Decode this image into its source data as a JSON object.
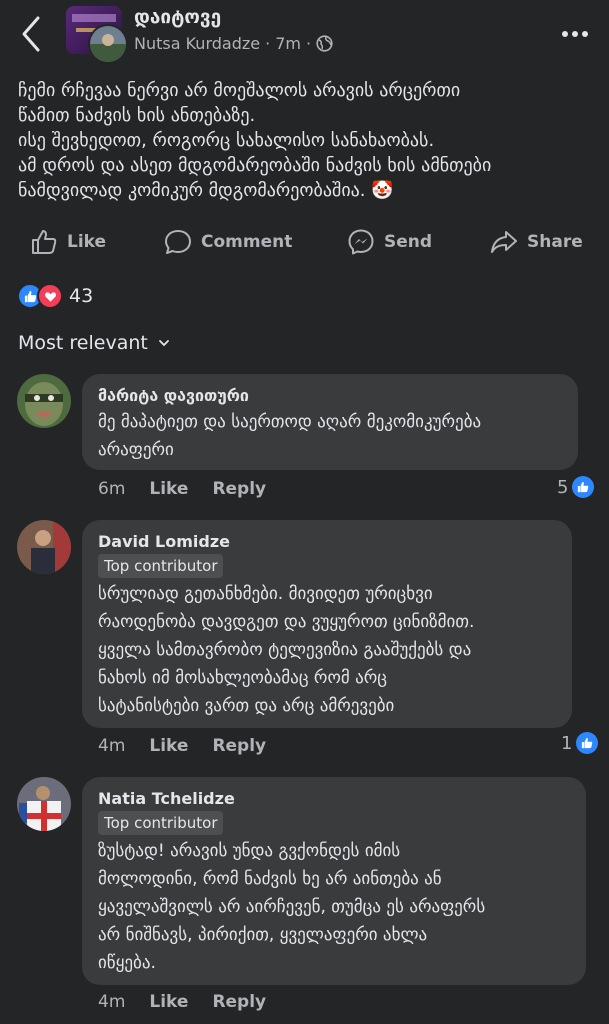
{
  "header": {
    "group_name": "დაიტოვე",
    "author": "Nutsa Kurdadze",
    "separator": "·",
    "time": "7m",
    "separator2": "·"
  },
  "post": {
    "lines": [
      "ჩემი რჩევაა ნერვი არ მოეშალოს არავის არცერთი",
      "წამით ნაძვის ხის ანთებაზე.",
      "ისე შევხედოთ, როგორც სახალისო სანახაობას.",
      "ამ დროს და ასეთ მდგომარეობაში ნაძვის ხის ამნთები",
      "ნამდვილად კომიკურ მდგომარეობაშია. 🤡"
    ]
  },
  "actions": {
    "like": "Like",
    "comment": "Comment",
    "send": "Send",
    "share": "Share"
  },
  "reactions": {
    "count": "43"
  },
  "sort": {
    "label": "Most relevant"
  },
  "comments": [
    {
      "name": "მარიტა დავითური",
      "lines": [
        "მე მაპატიეთ და საერთოდ აღარ მეკომიკურება",
        "არაფერი"
      ],
      "time": "6m",
      "like": "Like",
      "reply": "Reply",
      "reactions": "5"
    },
    {
      "name": "David Lomidze",
      "badge": "Top contributor",
      "lines": [
        "სრულიად გეთანხმები. მივიდეთ ურიცხვი",
        "რაოდენობა დავდგეთ და ვუყუროთ ცინიზმით.",
        "ყველა სამთავრობო ტელევიზია გააშუქებს და",
        "ნახოს იმ მოსახლეობამაც რომ არც",
        "სატანისტები ვართ და არც ამრევები"
      ],
      "time": "4m",
      "like": "Like",
      "reply": "Reply",
      "reactions": "1"
    },
    {
      "name": "Natia Tchelidze",
      "badge": "Top contributor",
      "lines": [
        "ზუსტად! არავის უნდა გვქონდეს იმის",
        "მოლოდინი, რომ ნაძვის ხე არ აინთება ან",
        "ყაველაშვილს არ აირჩევენ, თუმცა ეს არაფერს",
        "არ ნიშნავს, პირიქით, ყველაფერი ახლა",
        "იწყება."
      ],
      "time": "4m",
      "like": "Like",
      "reply": "Reply"
    }
  ],
  "colors": {
    "background": "#242526",
    "bubble": "#3a3b3c",
    "text": "#e4e6eb",
    "secondary": "#b0b3b8",
    "like_blue": "#2d88ff",
    "love_red": "#f33e58"
  }
}
